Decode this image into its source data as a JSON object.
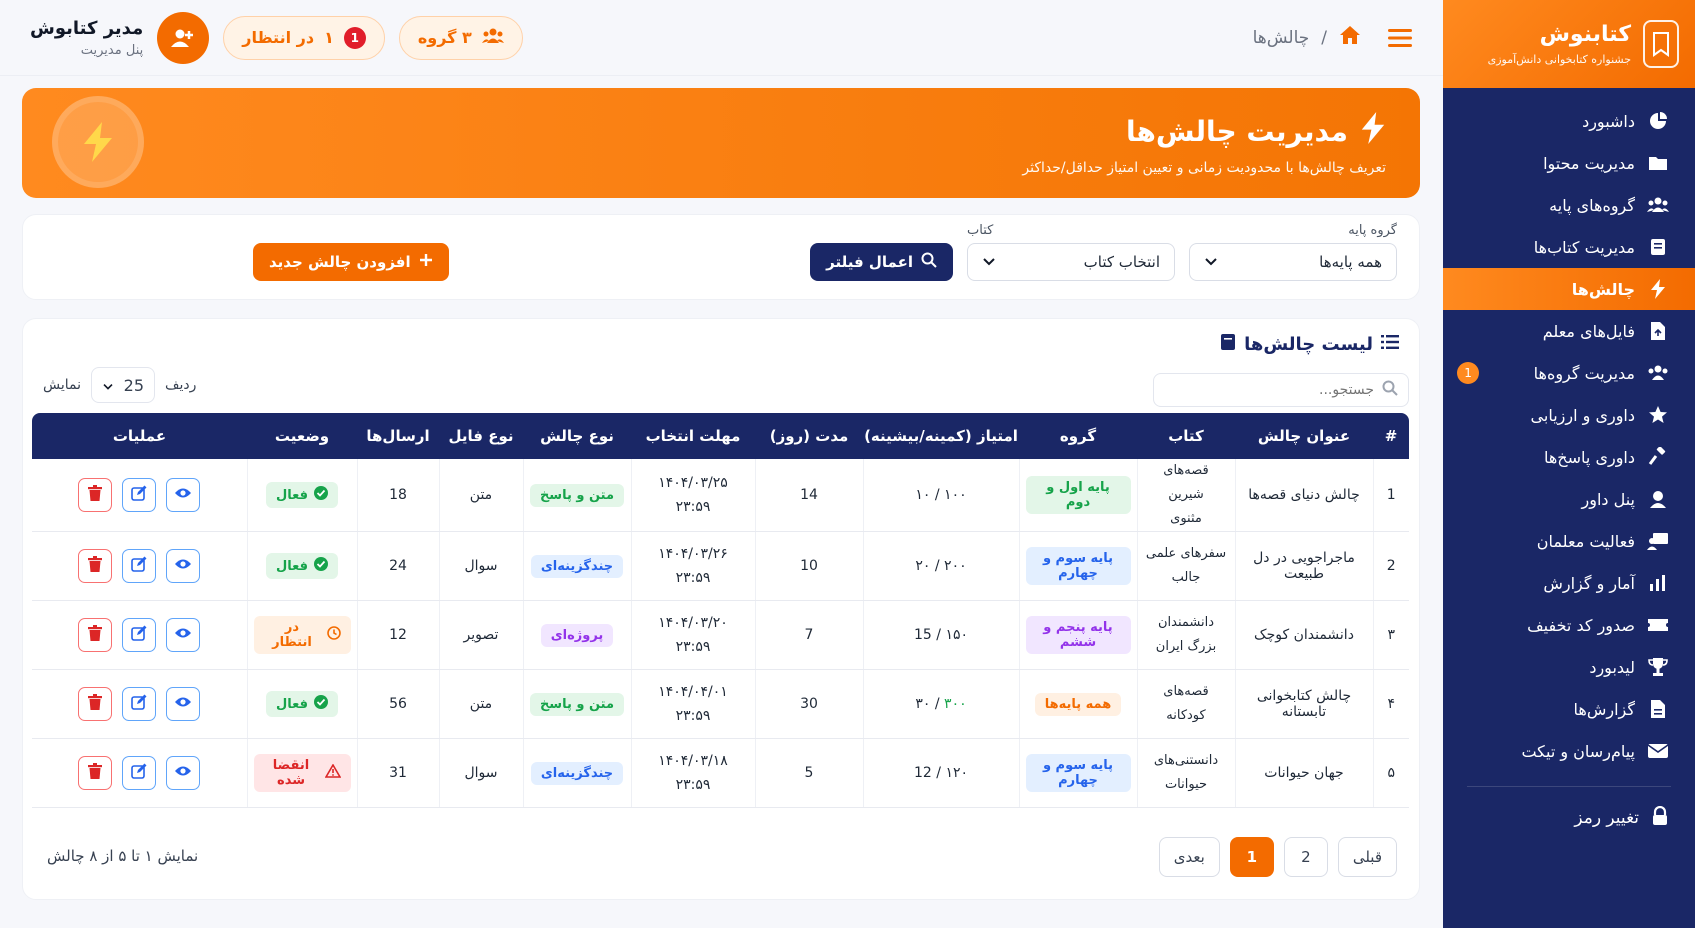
{
  "brand": {
    "title": "کتابنوش",
    "subtitle": "جشنواره کتابخوانی دانش‌آموزی"
  },
  "sidebar": {
    "items": [
      {
        "label": "داشبورد",
        "icon": "pie-chart-icon"
      },
      {
        "label": "مدیریت محتوا",
        "icon": "folder-icon"
      },
      {
        "label": "گروه‌های پایه",
        "icon": "users-icon"
      },
      {
        "label": "مدیریت کتاب‌ها",
        "icon": "book-icon"
      },
      {
        "label": "چالش‌ها",
        "icon": "bolt-icon",
        "active": true
      },
      {
        "label": "فایل‌های معلم",
        "icon": "file-upload-icon"
      },
      {
        "label": "مدیریت گروه‌ها",
        "icon": "users-group-icon",
        "badge": "1"
      },
      {
        "label": "داوری و ارزیابی",
        "icon": "star-icon"
      },
      {
        "label": "داوری پاسخ‌ها",
        "icon": "gavel-icon"
      },
      {
        "label": "پنل داور",
        "icon": "judge-icon"
      },
      {
        "label": "فعالیت معلمان",
        "icon": "teacher-icon"
      },
      {
        "label": "آمار و گزارش",
        "icon": "bar-chart-icon"
      },
      {
        "label": "صدور کد تخفیف",
        "icon": "ticket-icon"
      },
      {
        "label": "لیدبورد",
        "icon": "trophy-icon"
      },
      {
        "label": "گزارش‌ها",
        "icon": "report-icon"
      },
      {
        "label": "پیام‌رسان و تیکت",
        "icon": "envelope-icon"
      }
    ],
    "change_password": "تغییر رمز"
  },
  "topbar": {
    "breadcrumb": "چالش‌ها",
    "breadcrumb_sep": "/",
    "groups_pill": "۳ گروه",
    "pending_pill": "در انتظار",
    "pending_count": "۱",
    "admin_name": "مدیر کتابوش",
    "admin_role": "پنل مدیریت"
  },
  "hero": {
    "title": "مدیریت چالش‌ها",
    "subtitle": "تعریف چالش‌ها با محدودیت زمانی و تعیین امتیاز حداقل/حداکثر"
  },
  "filters": {
    "group_label": "گروه پایه",
    "group_value": "همه پایه‌ها",
    "book_label": "کتاب",
    "book_value": "انتخاب کتاب",
    "apply_label": "اعمال فیلتر",
    "add_label": "افزودن چالش جدید"
  },
  "list": {
    "title": "لیست چالش‌ها",
    "search_placeholder": "جستجو...",
    "show_label": "نمایش",
    "per_page": "25",
    "rows_label": "ردیف",
    "headers": [
      "#",
      "عنوان چالش",
      "کتاب",
      "گروه",
      "امتیاز (کمینه/بیشینه)",
      "مدت (روز)",
      "مهلت انتخاب",
      "نوع چالش",
      "نوع فایل",
      "ارسال‌ها",
      "وضعیت",
      "عملیات"
    ],
    "rows": [
      {
        "num": "1",
        "title": "چالش دنیای قصه‌ها",
        "book1": "قصه‌های شیرین",
        "book2": "مثنوی",
        "group": "پایه اول و دوم",
        "group_color": "green",
        "score_min": "۱۰",
        "score_max": "۱۰۰",
        "duration": "14",
        "date": "۱۴۰۴/۰۳/۲۵",
        "time": "۲۳:۵۹",
        "type": "متن و پاسخ",
        "type_color": "green",
        "file": "متن",
        "sends": "18",
        "status": "فعال",
        "status_kind": "active"
      },
      {
        "num": "2",
        "title": "ماجراجویی در دل طبیعت",
        "book1": "سفرهای علمی",
        "book2": "جالب",
        "group": "پایه سوم و چهارم",
        "group_color": "blue",
        "score_min": "۲۰",
        "score_max": "۲۰۰",
        "duration": "10",
        "date": "۱۴۰۴/۰۳/۲۶",
        "time": "۲۳:۵۹",
        "type": "چندگزینه‌ای",
        "type_color": "blue",
        "file": "سوال",
        "sends": "24",
        "status": "فعال",
        "status_kind": "active"
      },
      {
        "num": "۳",
        "title": "دانشمندان کوچک",
        "book1": "دانشمندان",
        "book2": "بزرگ ایران",
        "group": "پایه پنجم و ششم",
        "group_color": "purple",
        "score_min": "15",
        "score_max": "۱۵۰",
        "duration": "7",
        "date": "۱۴۰۴/۰۳/۲۰",
        "time": "۲۳:۵۹",
        "type": "پروژه‌ای",
        "type_color": "purple",
        "file": "تصویر",
        "sends": "12",
        "status": "در انتظار",
        "status_kind": "pending"
      },
      {
        "num": "۴",
        "title": "چالش کتابخوانی تابستانه",
        "book1": "قصه‌های",
        "book2": "کودکانه",
        "group": "همه پایه‌ها",
        "group_color": "orange",
        "score_min": "۳۰",
        "score_max": "۳۰۰",
        "duration": "30",
        "date": "۱۴۰۴/۰۴/۰۱",
        "time": "۲۳:۵۹",
        "type": "متن و پاسخ",
        "type_color": "green",
        "file": "متن",
        "sends": "56",
        "status": "فعال",
        "status_kind": "active"
      },
      {
        "num": "۵",
        "title": "جهان حیوانات",
        "book1": "دانستنی‌های",
        "book2": "حیوانات",
        "group": "پایه سوم و چهارم",
        "group_color": "blue",
        "score_min": "12",
        "score_max": "۱۲۰",
        "duration": "5",
        "date": "۱۴۰۴/۰۳/۱۸",
        "time": "۲۳:۵۹",
        "type": "چندگزینه‌ای",
        "type_color": "blue",
        "file": "سوال",
        "sends": "31",
        "status": "انقضا شده",
        "status_kind": "expired"
      }
    ]
  },
  "pagination": {
    "info": "نمایش ۱ تا ۵ از ۸ چالش",
    "prev": "قبلی",
    "pages": [
      "1",
      "2"
    ],
    "current": "1",
    "next": "بعدی"
  },
  "colors": {
    "accent": "#f36b00",
    "navy": "#1a2766"
  }
}
